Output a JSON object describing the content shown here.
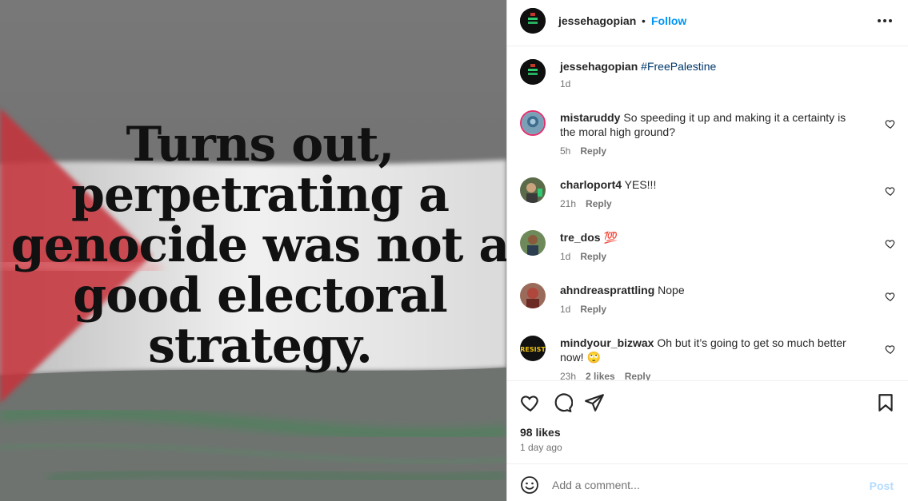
{
  "post": {
    "headline_lines": [
      "Turns out,",
      "perpetrating a",
      "genocide was not a",
      "good electoral",
      "strategy."
    ]
  },
  "header": {
    "username": "jessehagopian",
    "separator": "•",
    "follow_label": "Follow",
    "more_icon": "more-horizontal-icon"
  },
  "caption": {
    "username": "jessehagopian",
    "text": "#FreePalestine",
    "time": "1d"
  },
  "comments": [
    {
      "username": "mistaruddy",
      "text": "So speeding it up and making it a certainty is the moral high ground?",
      "time": "5h",
      "likes": "",
      "reply": "Reply"
    },
    {
      "username": "charloport4",
      "text": "YES!!!",
      "time": "21h",
      "likes": "",
      "reply": "Reply"
    },
    {
      "username": "tre_dos",
      "text": "💯",
      "time": "1d",
      "likes": "",
      "reply": "Reply"
    },
    {
      "username": "ahndreasprattling",
      "text": "Nope",
      "time": "1d",
      "likes": "",
      "reply": "Reply"
    },
    {
      "username": "mindyour_bizwax",
      "text": "Oh but it’s going to get so much better now! 🙄",
      "time": "23h",
      "likes": "2 likes",
      "reply": "Reply"
    }
  ],
  "actions": {
    "likes": "98 likes",
    "timestamp": "1 day ago"
  },
  "composer": {
    "placeholder": "Add a comment...",
    "post_label": "Post"
  },
  "colors": {
    "accent": "#0095f6",
    "post_disabled": "#b3dbff",
    "hashtag": "#00376b",
    "flag_red": "#c8303a",
    "flag_green": "#2e8b4a"
  }
}
